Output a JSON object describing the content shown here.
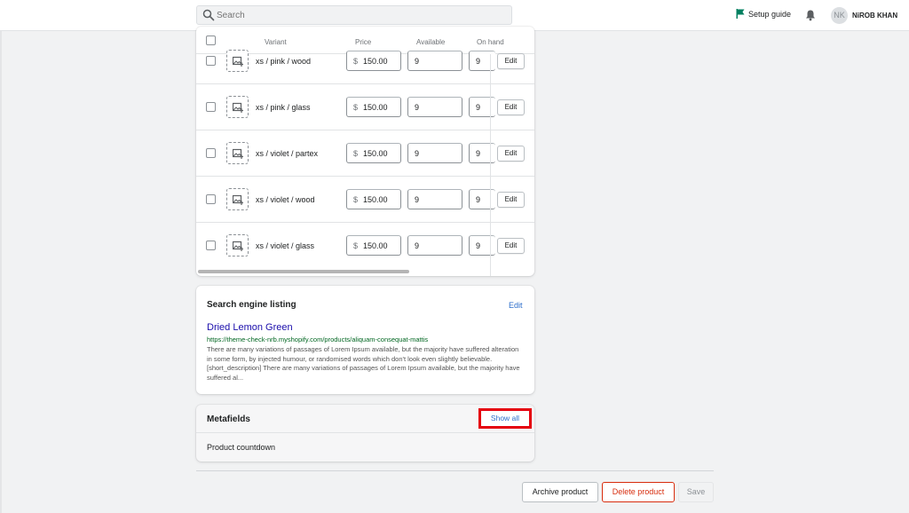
{
  "topbar": {
    "search_placeholder": "Search",
    "setup_guide": "Setup guide",
    "avatar_initials": "NK",
    "user_name": "NiROB KHAN"
  },
  "variants": {
    "headers": {
      "variant": "Variant",
      "price": "Price",
      "available": "Available",
      "on_hand": "On hand"
    },
    "rows": [
      {
        "name": "xs / pink / wood",
        "currency": "$",
        "price": "150.00",
        "available": "9",
        "on_hand": "9",
        "edit": "Edit"
      },
      {
        "name": "xs / pink / glass",
        "currency": "$",
        "price": "150.00",
        "available": "9",
        "on_hand": "9",
        "edit": "Edit"
      },
      {
        "name": "xs / violet / partex",
        "currency": "$",
        "price": "150.00",
        "available": "9",
        "on_hand": "9",
        "edit": "Edit"
      },
      {
        "name": "xs / violet / wood",
        "currency": "$",
        "price": "150.00",
        "available": "9",
        "on_hand": "9",
        "edit": "Edit"
      },
      {
        "name": "xs / violet / glass",
        "currency": "$",
        "price": "150.00",
        "available": "9",
        "on_hand": "9",
        "edit": "Edit"
      }
    ]
  },
  "seo": {
    "title": "Search engine listing",
    "edit": "Edit",
    "product_name": "Dried Lemon Green",
    "url": "https://theme-check-nrb.myshopify.com/products/aliquam-consequat-mattis",
    "description": "There are many variations of passages of Lorem Ipsum available, but the majority have suffered alteration in some form, by injected humour, or randomised words which don't look even slightly believable. [short_description] There are many variations of passages of Lorem Ipsum available, but the majority have suffered al..."
  },
  "metafields": {
    "title": "Metafields",
    "show_all": "Show all",
    "item": "Product countdown",
    "highlight_color": "#e5000e"
  },
  "footer": {
    "archive": "Archive product",
    "delete": "Delete product",
    "save": "Save"
  },
  "colors": {
    "link": "#2c6ecb",
    "critical": "#d72c0d",
    "seo_title": "#1a0dab",
    "seo_url": "#006621"
  }
}
